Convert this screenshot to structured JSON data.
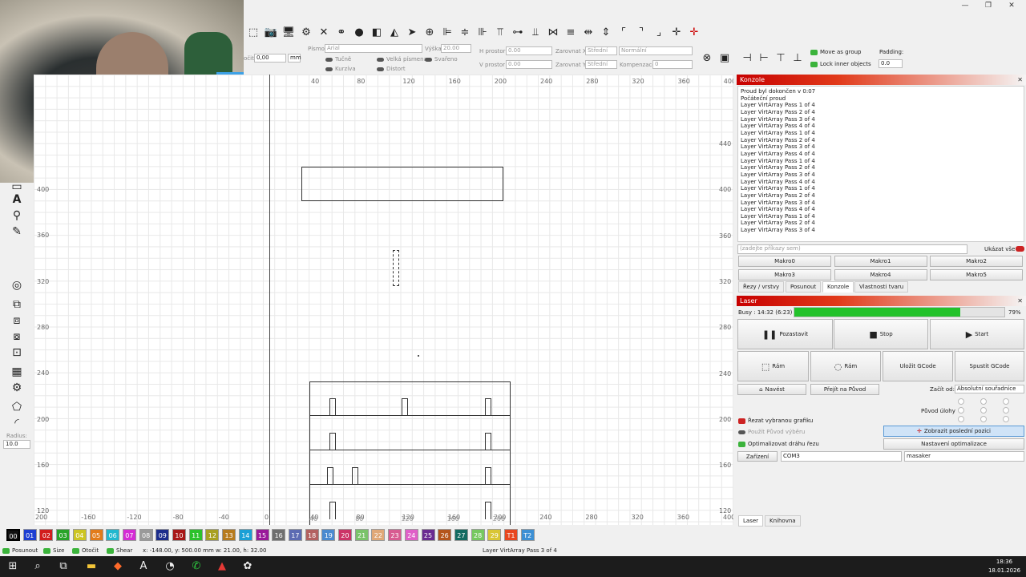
{
  "window": {
    "minimize": "—",
    "maximize": "❐",
    "close": "✕"
  },
  "toolbar": {
    "rotate_label": "očit",
    "rotate_value": "0,00",
    "unit": "mm",
    "font_label": "Písmo",
    "font_value": "Arial",
    "height_label": "Výška",
    "height_value": "20.00",
    "hspace_label": "H prostor",
    "hspace_value": "0.00",
    "vspace_label": "V prostor",
    "vspace_value": "0.00",
    "alignx_label": "Zarovnat X",
    "alignx_value": "Střední",
    "aligny_label": "Zarovnat Y",
    "aligny_value": "Střední",
    "mode_value": "Normální",
    "comp_label": "Kompenzace",
    "comp_value": "0",
    "bold": "Tučně",
    "italic": "Kurzíva",
    "caps": "Velká písmena",
    "welded": "Svařeno",
    "distort": "Distort",
    "move_as_group": "Move as group",
    "lock_inner": "Lock inner objects",
    "padding_label": "Padding:",
    "padding_value": "0.0"
  },
  "left_tools": {
    "radius_label": "Radius:",
    "radius_value": "10.0"
  },
  "ruler": {
    "top": [
      "40",
      "80",
      "120",
      "160",
      "200",
      "240",
      "280",
      "320",
      "360",
      "400"
    ],
    "bottom": [
      "200",
      "-160",
      "-120",
      "-80",
      "-40",
      "0",
      "40",
      "80",
      "120",
      "160",
      "200",
      "240",
      "280",
      "320",
      "360",
      "400"
    ],
    "left": [
      "400",
      "360",
      "320",
      "280",
      "240",
      "200",
      "160",
      "120"
    ],
    "right": [
      "440",
      "400",
      "360",
      "320",
      "280",
      "240",
      "200",
      "160",
      "120"
    ],
    "bottom_inner": [
      "40",
      "80",
      "120",
      "160",
      "200"
    ]
  },
  "console": {
    "title": "Konzole",
    "lines": [
      "Proud byl dokončen v 0:07",
      "Počáteční proud",
      "Layer VirtArray Pass 1 of 4",
      "Layer VirtArray Pass 2 of 4",
      "Layer VirtArray Pass 3 of 4",
      "Layer VirtArray Pass 4 of 4",
      "Layer VirtArray Pass 1 of 4",
      "Layer VirtArray Pass 2 of 4",
      "Layer VirtArray Pass 3 of 4",
      "Layer VirtArray Pass 4 of 4",
      "Layer VirtArray Pass 1 of 4",
      "Layer VirtArray Pass 2 of 4",
      "Layer VirtArray Pass 3 of 4",
      "Layer VirtArray Pass 4 of 4",
      "Layer VirtArray Pass 1 of 4",
      "Layer VirtArray Pass 2 of 4",
      "Layer VirtArray Pass 3 of 4",
      "Layer VirtArray Pass 4 of 4",
      "Layer VirtArray Pass 1 of 4",
      "Layer VirtArray Pass 2 of 4",
      "Layer VirtArray Pass 3 of 4"
    ],
    "placeholder": "(zadejte příkazy sem)",
    "show_all": "Ukázat vše",
    "macros": [
      "Makro0",
      "Makro1",
      "Makro2",
      "Makro3",
      "Makro4",
      "Makro5"
    ],
    "tabs": [
      "Řezy / vrstvy",
      "Posunout",
      "Konzole",
      "Vlastnosti tvaru"
    ]
  },
  "laser": {
    "title": "Laser",
    "status": "Busy : 14:32 (6:23)",
    "progress": 0.79,
    "progress_text": "79%",
    "pause": "Pozastavit",
    "stop": "Stop",
    "start": "Start",
    "frame1": "Rám",
    "frame2": "Rám",
    "save_gcode": "Uložit GCode",
    "run_gcode": "Spustit GCode",
    "home": "Navést",
    "goto_origin": "Přejít na Původ",
    "start_from_label": "Začít od:",
    "start_from_value": "Absolutní souřadnice",
    "job_origin_label": "Původ úlohy",
    "cut_selected": "Řezat vybranou grafiku",
    "use_selection_origin": "Použít Původ výběru",
    "optimize_path": "Optimalizovat dráhu řezu",
    "show_last_pos": "Zobrazit poslední pozici",
    "opt_settings": "Nastavení optimalizace",
    "device_btn": "Zařízení",
    "port": "COM3",
    "device": "masaker",
    "tabs": [
      "Laser",
      "Knihovna"
    ]
  },
  "palette": [
    {
      "label": "00",
      "color": "#111111"
    },
    {
      "label": "01",
      "color": "#1d3fd1"
    },
    {
      "label": "02",
      "color": "#d21d1d"
    },
    {
      "label": "03",
      "color": "#27a327"
    },
    {
      "label": "04",
      "color": "#cdc521"
    },
    {
      "label": "05",
      "color": "#e27b1a"
    },
    {
      "label": "06",
      "color": "#21b8cf"
    },
    {
      "label": "07",
      "color": "#d52bd5"
    },
    {
      "label": "08",
      "color": "#9a9a9a"
    },
    {
      "label": "09",
      "color": "#1c2d8c"
    },
    {
      "label": "10",
      "color": "#a81616"
    },
    {
      "label": "11",
      "color": "#2cc22c"
    },
    {
      "label": "12",
      "color": "#a8a022"
    },
    {
      "label": "13",
      "color": "#b77b1d"
    },
    {
      "label": "14",
      "color": "#1aa0d6"
    },
    {
      "label": "15",
      "color": "#9a1a9a"
    },
    {
      "label": "16",
      "color": "#6f6f6f"
    },
    {
      "label": "17",
      "color": "#5c6bb3"
    },
    {
      "label": "18",
      "color": "#b36060"
    },
    {
      "label": "19",
      "color": "#4a8ad0"
    },
    {
      "label": "20",
      "color": "#cc3366"
    },
    {
      "label": "21",
      "color": "#7ac36a"
    },
    {
      "label": "22",
      "color": "#e0a878"
    },
    {
      "label": "23",
      "color": "#d85b91"
    },
    {
      "label": "24",
      "color": "#e05fc8"
    },
    {
      "label": "25",
      "color": "#6b2b91"
    },
    {
      "label": "26",
      "color": "#b5551c"
    },
    {
      "label": "27",
      "color": "#136b61"
    },
    {
      "label": "28",
      "color": "#76c860"
    },
    {
      "label": "29",
      "color": "#d9c635"
    },
    {
      "label": "T1",
      "color": "#e8471f"
    },
    {
      "label": "T2",
      "color": "#3c8fd4"
    }
  ],
  "status": {
    "move": "Posunout",
    "size": "Size",
    "rotate": "Otočit",
    "shear": "Shear",
    "coords": "x: -148.00, y: 500.00 mm  w: 21.00,  h: 32.00",
    "message": "Layer VirtArray Pass 3 of 4"
  },
  "taskbar": {
    "time": "18:36",
    "date": "18.01.2026"
  }
}
